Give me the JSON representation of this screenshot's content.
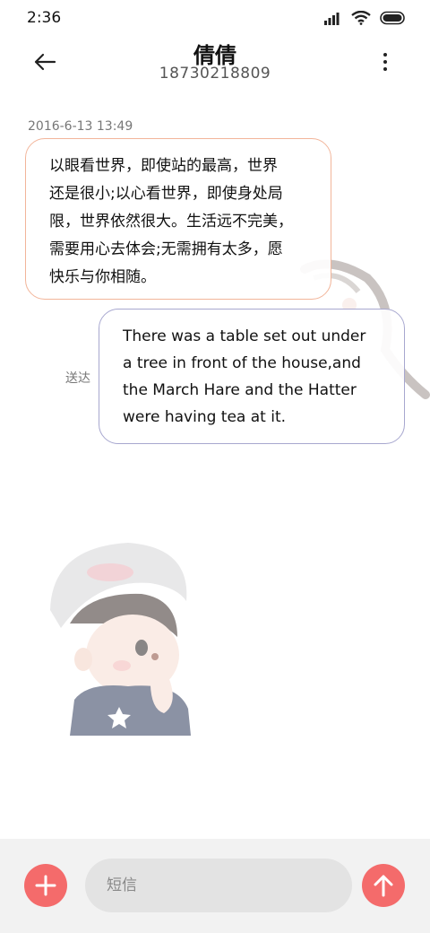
{
  "status_bar": {
    "time": "2:36",
    "signal_icon": "cellular-signal-icon",
    "wifi_icon": "wifi-icon",
    "battery_icon": "battery-icon"
  },
  "header": {
    "contact_name": "倩倩",
    "phone_number": "18730218809",
    "back_icon": "back-arrow-icon",
    "more_icon": "more-vertical-icon"
  },
  "conversation": {
    "timestamp": "2016-6-13 13:49",
    "incoming": {
      "lines": [
        "以眼看世界，即使站的最高，世界",
        "还是很小;以心看世界，即使身处局",
        "限，世界依然很大。生活远不完美，",
        "需要用心去体会;无需拥有太多，愿",
        "快乐与你相随。"
      ]
    },
    "outgoing": {
      "lines": [
        "There was a table set out under",
        "a tree in front of the house,and",
        "the March Hare and the Hatter",
        "were having tea at it."
      ],
      "status": "送达"
    }
  },
  "composer": {
    "placeholder": "短信",
    "add_icon": "plus-icon",
    "send_icon": "send-arrow-icon"
  },
  "colors": {
    "accent": "#f46b6b",
    "incoming_border": "#f2b59a",
    "outgoing_border": "#a7a7cf",
    "composer_bg": "#f2f2f2",
    "input_bg": "#e3e3e3"
  }
}
